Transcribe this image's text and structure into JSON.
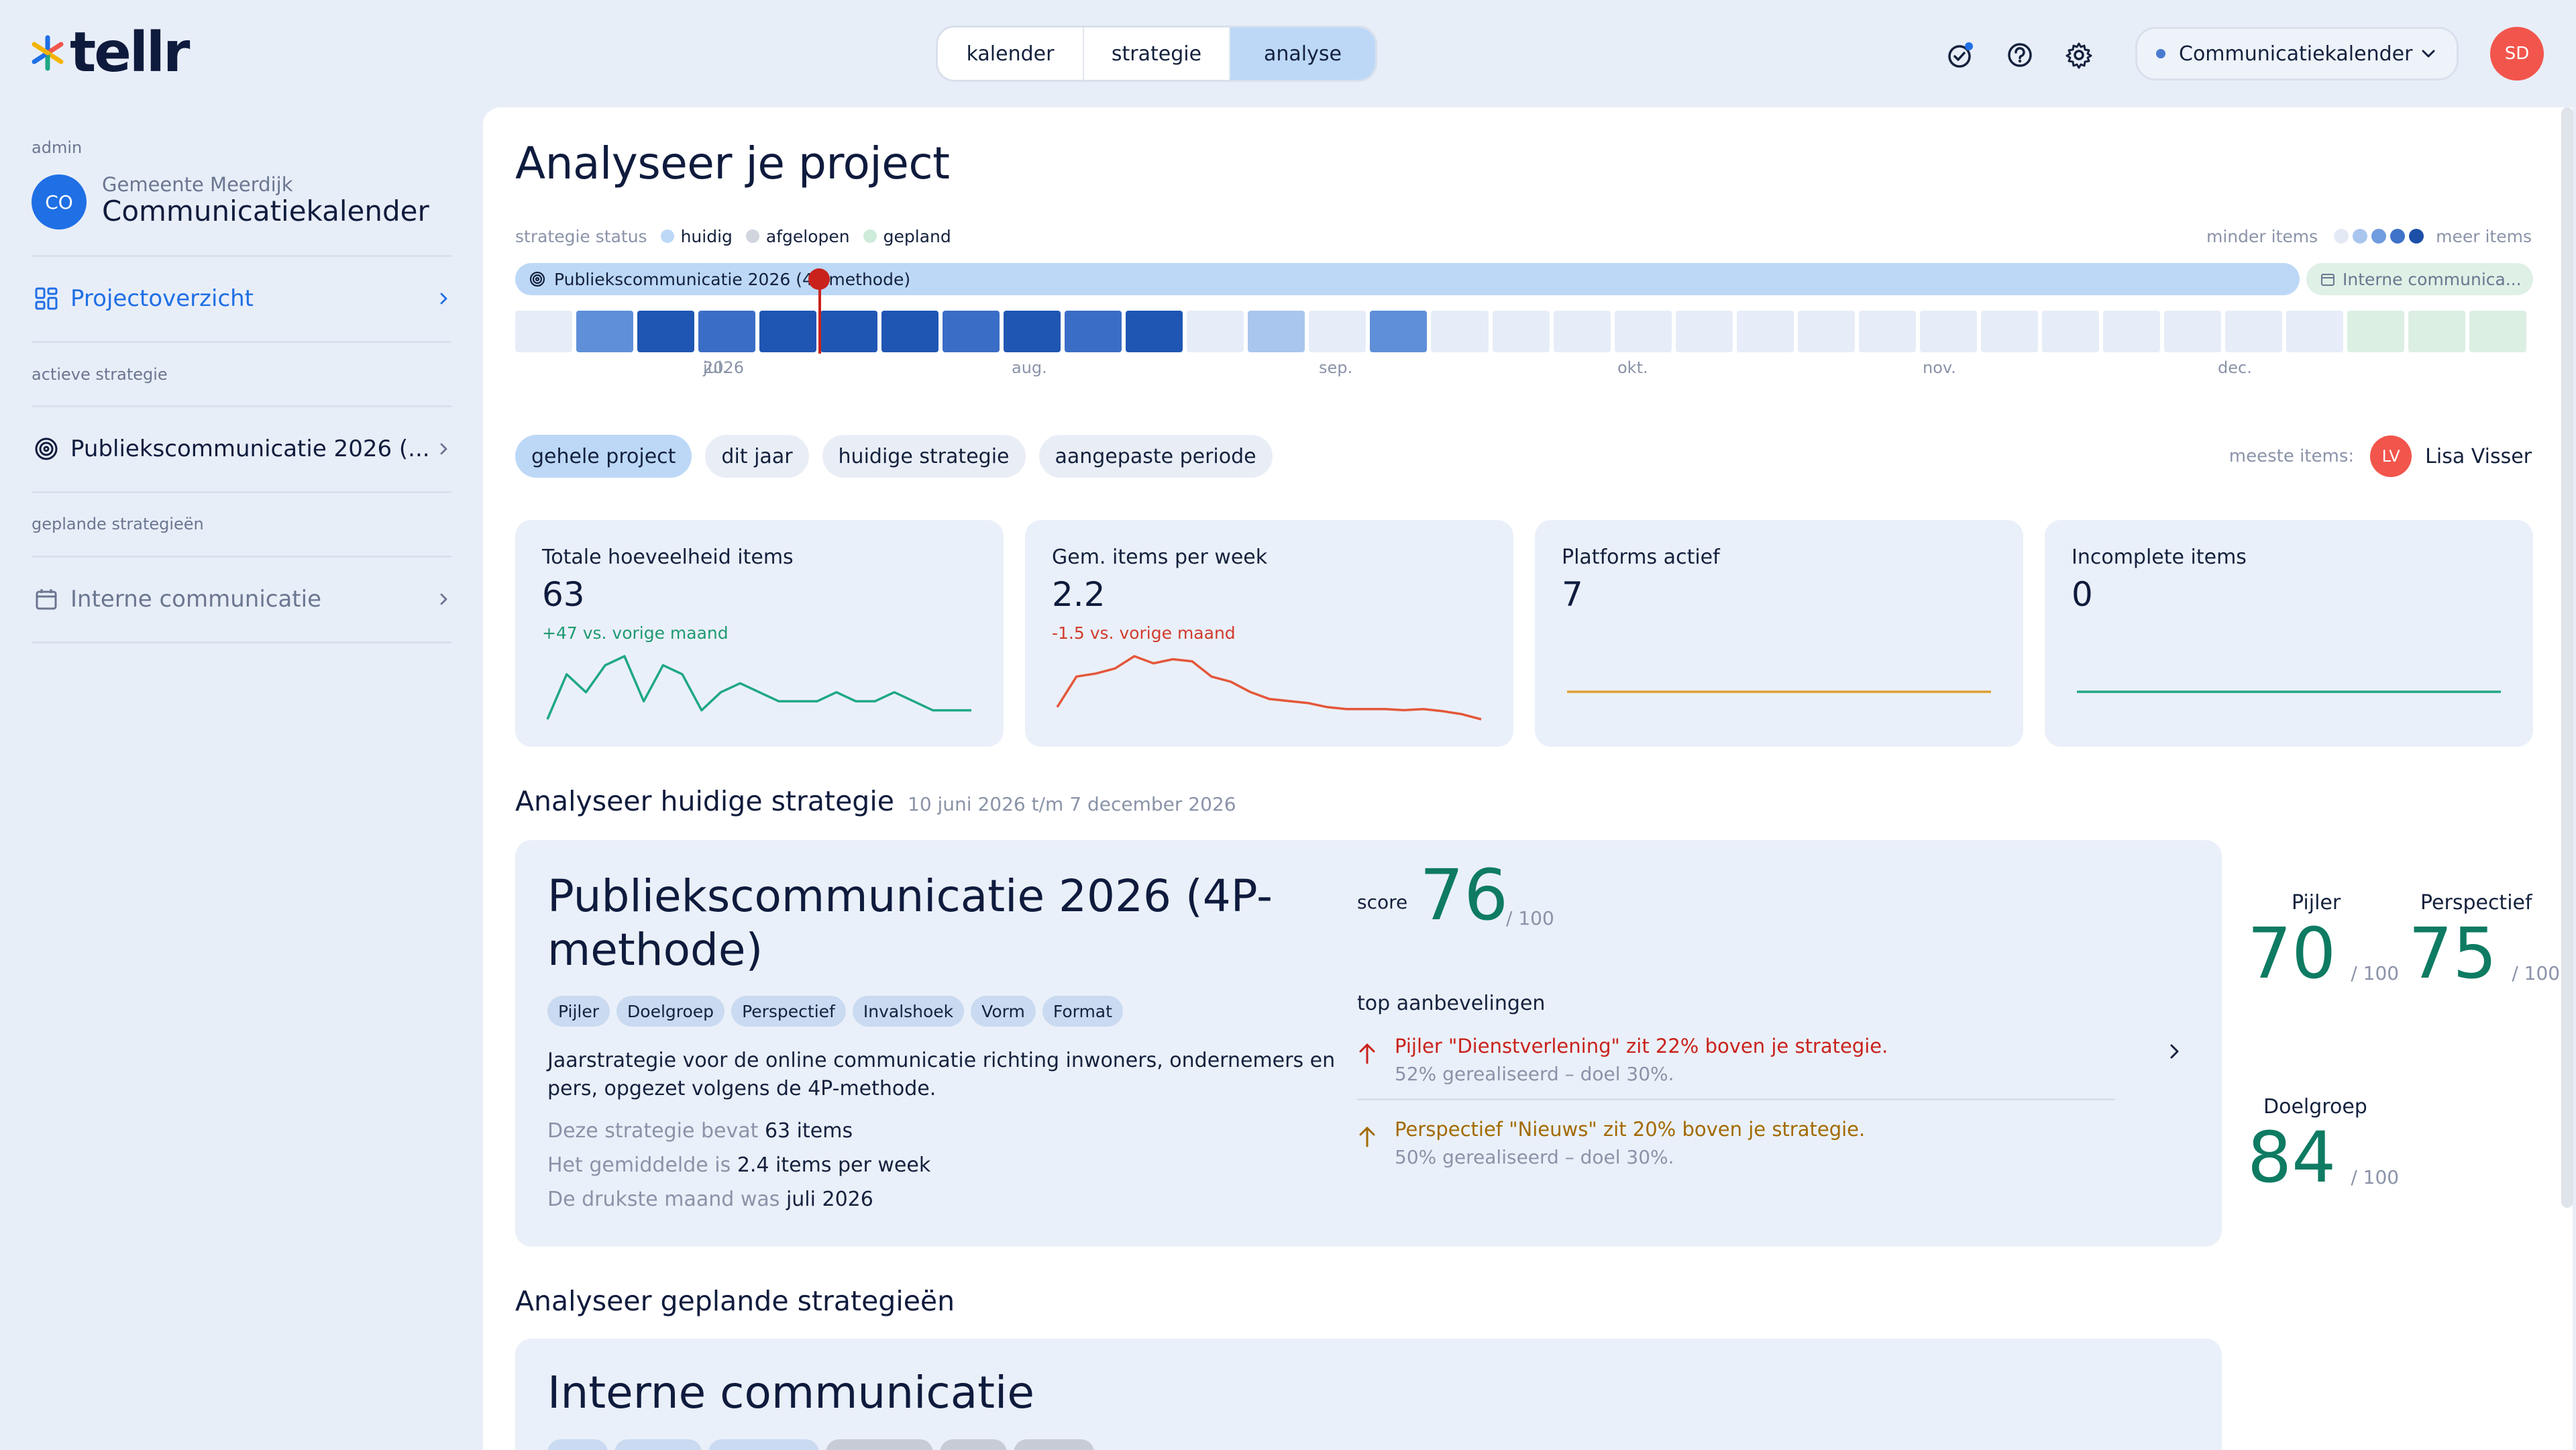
{
  "brand": {
    "name": "tellr",
    "accent": "#1f6fe5"
  },
  "topnav": {
    "tabs": [
      "kalender",
      "strategie",
      "analyse"
    ],
    "active": "analyse"
  },
  "header": {
    "calendar_selector": "Communicatiekalender",
    "user_initials": "SD",
    "icons": [
      "check-badge-icon",
      "help-icon",
      "settings-icon"
    ]
  },
  "sidebar": {
    "role": "admin",
    "project_initials": "CO",
    "organisation": "Gemeente Meerdijk",
    "project": "Communicatiekalender",
    "overview_label": "Projectoverzicht",
    "active_section": "actieve strategie",
    "active_strategy": "Publiekscommunicatie 2026 (...",
    "planned_section": "geplande strategieën",
    "planned_strategy": "Interne communicatie"
  },
  "main": {
    "title": "Analyseer je project",
    "status_legend": {
      "label": "strategie status",
      "items": [
        {
          "label": "huidig",
          "color": "#bdd8f7"
        },
        {
          "label": "afgelopen",
          "color": "#d0d5de"
        },
        {
          "label": "gepland",
          "color": "#cdebd9"
        }
      ]
    },
    "density_legend": {
      "less": "minder items",
      "more": "meer items"
    },
    "timeline": {
      "current_strategy": "Publiekscommunicatie 2026 (4P-methode)",
      "next_strategy": "Interne communica...",
      "months": [
        {
          "label": "jul.",
          "year": "2026"
        },
        {
          "label": "aug."
        },
        {
          "label": "sep."
        },
        {
          "label": "okt."
        },
        {
          "label": "nov."
        },
        {
          "label": "dec."
        }
      ],
      "week_levels": [
        0,
        2,
        4,
        3,
        4,
        4,
        4,
        3,
        4,
        3,
        4,
        0,
        1,
        0,
        2,
        0,
        0,
        0,
        0,
        0,
        0,
        0,
        0,
        0,
        0,
        0,
        0,
        0,
        0,
        0,
        5,
        5,
        5
      ]
    },
    "period_filters": [
      "gehele project",
      "dit jaar",
      "huidige strategie",
      "aangepaste periode"
    ],
    "active_filter": "gehele project",
    "most_items": {
      "label": "meeste items:",
      "initials": "LV",
      "name": "Lisa Visser"
    },
    "kpis": [
      {
        "title": "Totale hoeveelheid items",
        "value": "63",
        "delta": "+47 vs. vorige maand",
        "delta_color": "#1f9a72",
        "line_color": "#1fa883",
        "trend": [
          2,
          7,
          5,
          8,
          9,
          4,
          8,
          7,
          3,
          5,
          6,
          5,
          4,
          4,
          4,
          5,
          4,
          4,
          5,
          4,
          3,
          3,
          3
        ]
      },
      {
        "title": "Gem. items per week",
        "value": "2.2",
        "delta": "-1.5 vs. vorige maand",
        "delta_color": "#d23b2c",
        "line_color": "#e4573a",
        "trend": [
          3,
          6,
          6.3,
          6.8,
          8,
          7.3,
          7.7,
          7.5,
          6,
          5.5,
          4.5,
          3.8,
          3.6,
          3.4,
          3,
          2.8,
          2.8,
          2.8,
          2.7,
          2.8,
          2.6,
          2.3,
          1.8
        ]
      },
      {
        "title": "Platforms actief",
        "value": "7",
        "delta": "",
        "delta_color": "#1f9a72",
        "line_color": "#e0a030",
        "trend": [
          5,
          5,
          5,
          5,
          5,
          5,
          5,
          5,
          5,
          5,
          5,
          5,
          5,
          5,
          5,
          5,
          5,
          5,
          5,
          5,
          5,
          5,
          5
        ]
      },
      {
        "title": "Incomplete items",
        "value": "0",
        "delta": "",
        "delta_color": "#1f9a72",
        "line_color": "#1fa883",
        "trend": [
          5,
          5,
          5,
          5,
          5,
          5,
          5,
          5,
          5,
          5,
          5,
          5,
          5,
          5,
          5,
          5,
          5,
          5,
          5,
          5,
          5,
          5,
          5
        ]
      }
    ]
  },
  "current_strategy": {
    "section_title": "Analyseer huidige strategie",
    "period": "10 juni 2026 t/m 7 december 2026",
    "name": "Publiekscommunicatie 2026 (4P-methode)",
    "tags": [
      "Pijler",
      "Doelgroep",
      "Perspectief",
      "Invalshoek",
      "Vorm",
      "Format"
    ],
    "description": "Jaarstrategie voor de online communicatie richting inwoners, ondernemers en pers, opgezet volgens de 4P-methode.",
    "stats": [
      {
        "label": "Deze strategie bevat",
        "value": "63 items"
      },
      {
        "label": "Het gemiddelde is",
        "value": "2.4 items per week"
      },
      {
        "label": "De drukste maand was",
        "value": "juli 2026"
      }
    ],
    "score_label": "score",
    "score": "76",
    "score_max": "/ 100",
    "recommendations_title": "top aanbevelingen",
    "recommendations": [
      {
        "text": "Pijler \"Dienstverlening\" zit 22% boven je strategie.",
        "detail": "52% gerealiseerd – doel 30%.",
        "color": "#c9221c"
      },
      {
        "text": "Perspectief \"Nieuws\" zit 20% boven je strategie.",
        "detail": "50% gerealiseerd – doel 30%.",
        "color": "#a26a00"
      }
    ],
    "subscores": [
      {
        "label": "Pijler",
        "value": "70",
        "max": "/ 100"
      },
      {
        "label": "Perspectief",
        "value": "75",
        "max": "/ 100"
      },
      {
        "label": "Doelgroep",
        "value": "84",
        "max": "/ 100"
      }
    ]
  },
  "planned": {
    "section_title": "Analyseer geplande strategieën",
    "name": "Interne communicatie"
  }
}
